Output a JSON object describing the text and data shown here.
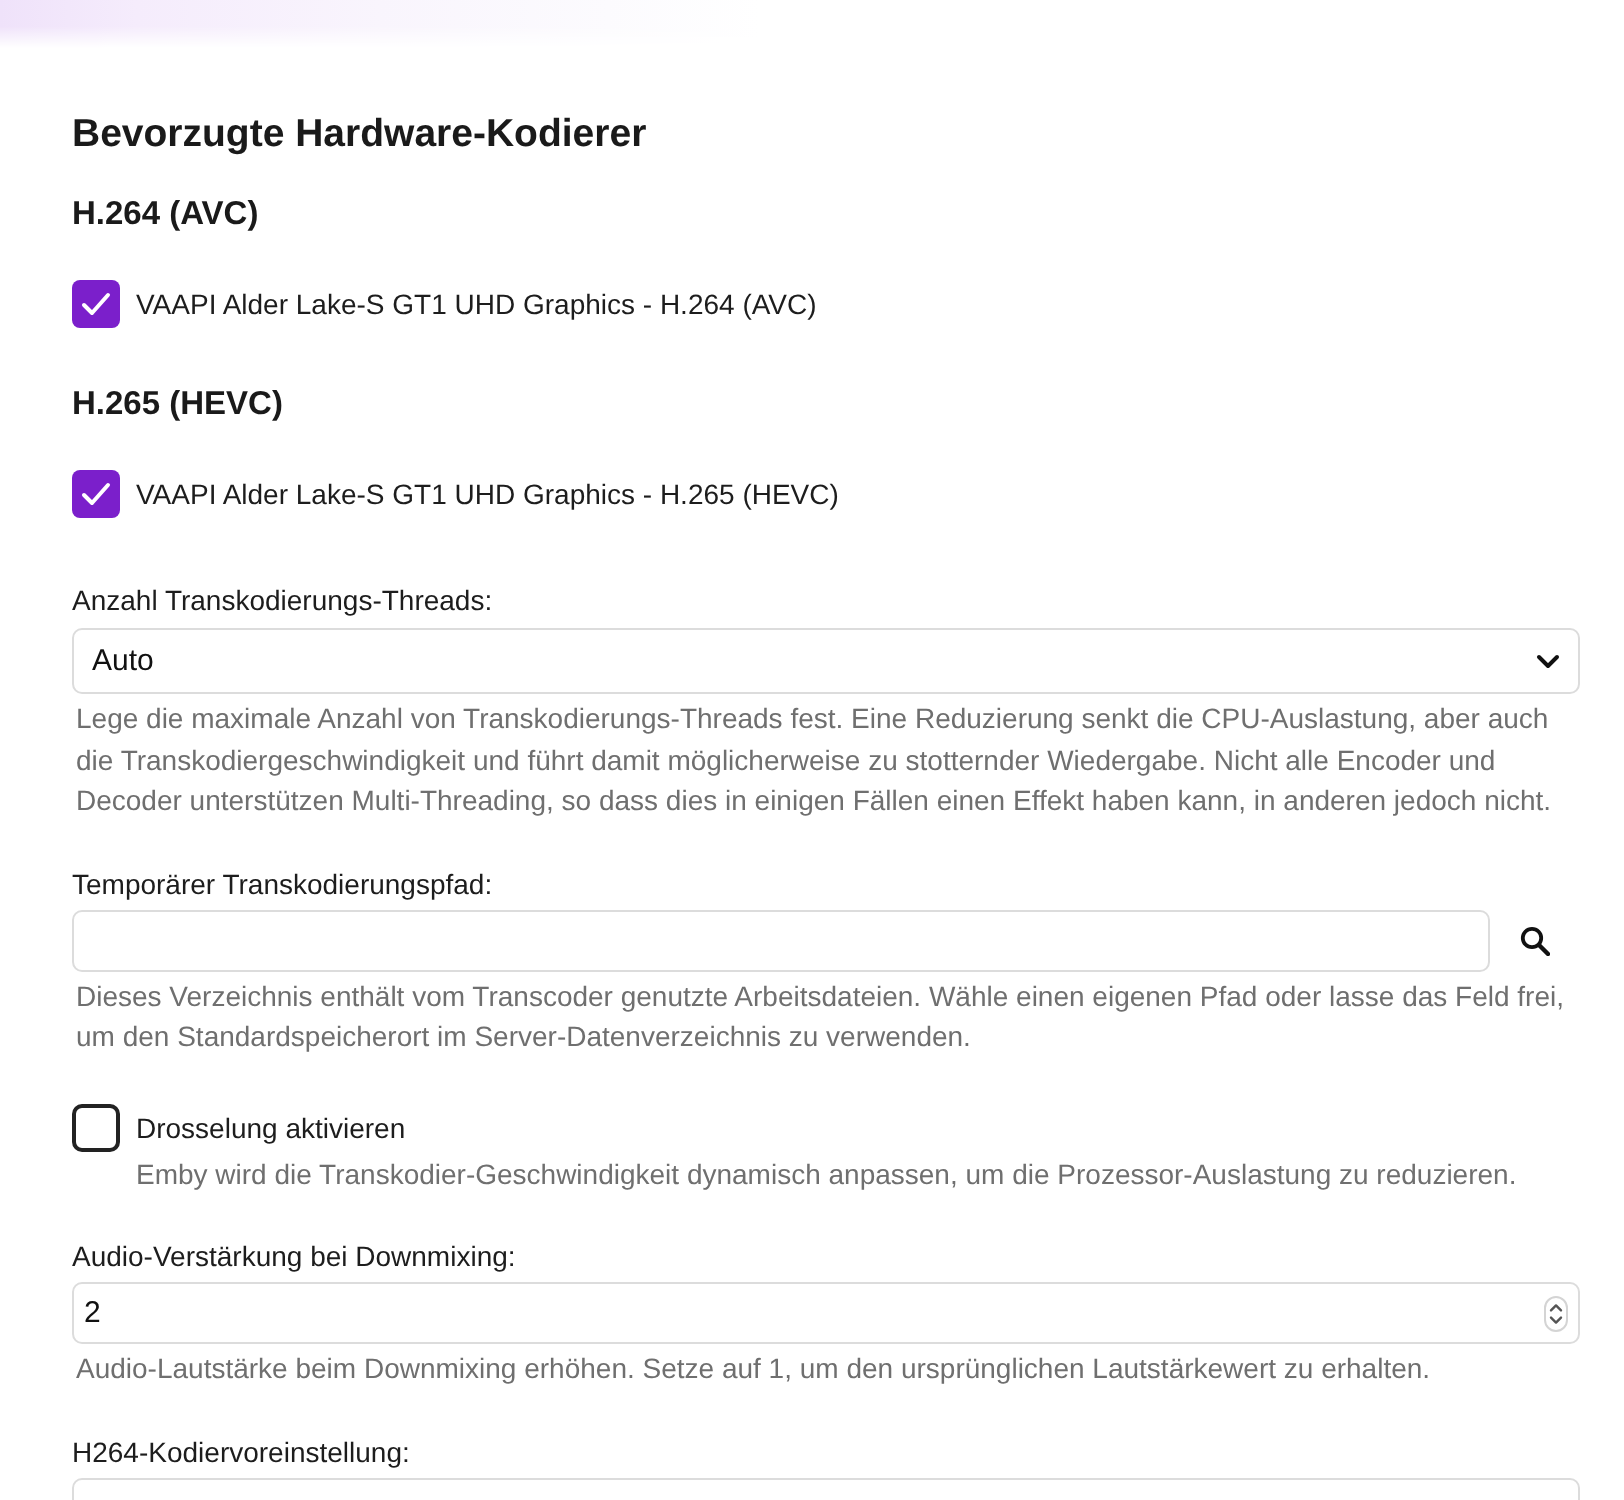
{
  "section_title": "Bevorzugte Hardware-Kodierer",
  "encoder_groups": [
    {
      "title": "H.264 (AVC)",
      "options": [
        {
          "label": "VAAPI Alder Lake-S GT1 UHD Graphics - H.264 (AVC)",
          "checked": true
        }
      ]
    },
    {
      "title": "H.265 (HEVC)",
      "options": [
        {
          "label": "VAAPI Alder Lake-S GT1 UHD Graphics - H.265 (HEVC)",
          "checked": true
        }
      ]
    }
  ],
  "settings": [
    {
      "kind": "select",
      "label": "Anzahl Transkodierungs-Threads:",
      "value": "Auto",
      "help": "Lege die maximale Anzahl von Transkodierungs-Threads fest. Eine Reduzierung senkt die CPU-Auslastung, aber auch die Transkodiergeschwindigkeit und führt damit möglicherweise zu stotternder Wiedergabe. Nicht alle Encoder und Decoder unterstützen Multi-Threading, so dass dies in einigen Fällen einen Effekt haben kann, in anderen jedoch nicht."
    },
    {
      "kind": "path",
      "label": "Temporärer Transkodierungspfad:",
      "help": "Dieses Verzeichnis enthält vom Transcoder genutzte Arbeitsdateien. Wähle einen eigenen Pfad oder lasse das Feld frei, um den Standardspeicherort im Server-Datenverzeichnis zu verwenden."
    },
    {
      "kind": "checkbox",
      "label": "Drosselung aktivieren",
      "checked": false,
      "help": "Emby wird die Transkodier-Geschwindigkeit dynamisch anpassen, um die Prozessor-Auslastung zu reduzieren."
    },
    {
      "kind": "number",
      "label": "Audio-Verstärkung bei Downmixing:",
      "value": "2",
      "help": "Audio-Lautstärke beim Downmixing erhöhen. Setze auf 1, um den ursprünglichen Lautstärkewert zu erhalten."
    },
    {
      "kind": "select",
      "label": "H264-Kodiervoreinstellung:"
    }
  ]
}
